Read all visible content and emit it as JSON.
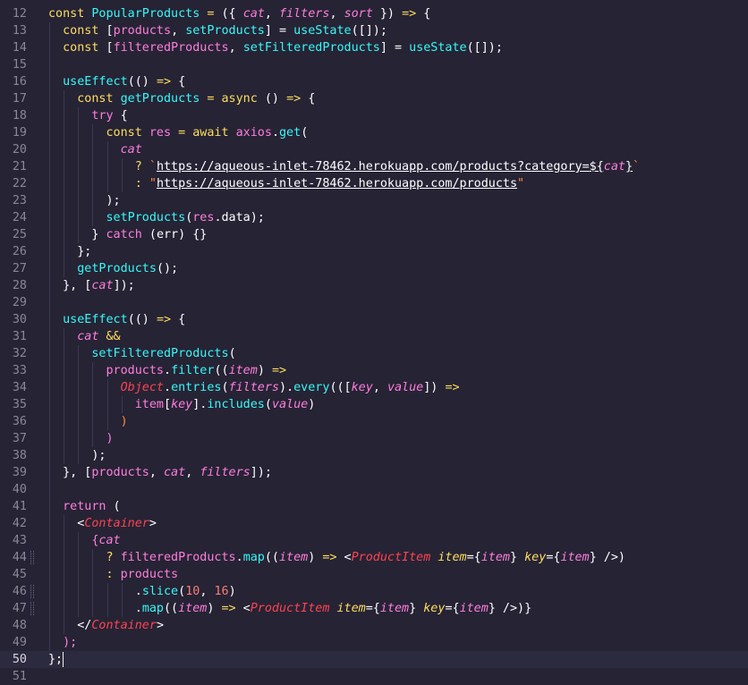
{
  "editor": {
    "active_line": 50,
    "lines": [
      {
        "n": "12",
        "indent": 0,
        "tokens": [
          {
            "t": "const ",
            "c": "kw"
          },
          {
            "t": "PopularProducts",
            "c": "fn"
          },
          {
            "t": " = ",
            "c": "op"
          },
          {
            "t": "({ ",
            "c": "plain"
          },
          {
            "t": "cat",
            "c": "param"
          },
          {
            "t": ", ",
            "c": "plain"
          },
          {
            "t": "filters",
            "c": "param"
          },
          {
            "t": ", ",
            "c": "plain"
          },
          {
            "t": "sort",
            "c": "param"
          },
          {
            "t": " }) ",
            "c": "plain"
          },
          {
            "t": "=>",
            "c": "op"
          },
          {
            "t": " {",
            "c": "plain"
          }
        ]
      },
      {
        "n": "13",
        "indent": 1,
        "tokens": [
          {
            "t": "const ",
            "c": "kw"
          },
          {
            "t": "[",
            "c": "plain"
          },
          {
            "t": "products",
            "c": "var"
          },
          {
            "t": ", ",
            "c": "plain"
          },
          {
            "t": "setProducts",
            "c": "fn"
          },
          {
            "t": "] = ",
            "c": "plain"
          },
          {
            "t": "useState",
            "c": "fn"
          },
          {
            "t": "([]);",
            "c": "plain"
          }
        ]
      },
      {
        "n": "14",
        "indent": 1,
        "tokens": [
          {
            "t": "const ",
            "c": "kw"
          },
          {
            "t": "[",
            "c": "plain"
          },
          {
            "t": "filteredProducts",
            "c": "var"
          },
          {
            "t": ", ",
            "c": "plain"
          },
          {
            "t": "setFilteredProducts",
            "c": "fn"
          },
          {
            "t": "] = ",
            "c": "plain"
          },
          {
            "t": "useState",
            "c": "fn"
          },
          {
            "t": "([]);",
            "c": "plain"
          }
        ]
      },
      {
        "n": "15",
        "indent": 1,
        "tokens": []
      },
      {
        "n": "16",
        "indent": 1,
        "tokens": [
          {
            "t": "useEffect",
            "c": "fn"
          },
          {
            "t": "(() ",
            "c": "plain"
          },
          {
            "t": "=>",
            "c": "op"
          },
          {
            "t": " {",
            "c": "plain"
          }
        ]
      },
      {
        "n": "17",
        "indent": 2,
        "tokens": [
          {
            "t": "const ",
            "c": "kw"
          },
          {
            "t": "getProducts",
            "c": "fn"
          },
          {
            "t": " = ",
            "c": "op"
          },
          {
            "t": "async ",
            "c": "kw"
          },
          {
            "t": "() ",
            "c": "plain"
          },
          {
            "t": "=>",
            "c": "op"
          },
          {
            "t": " {",
            "c": "plain"
          }
        ]
      },
      {
        "n": "18",
        "indent": 3,
        "tokens": [
          {
            "t": "try",
            "c": "var"
          },
          {
            "t": " {",
            "c": "plain"
          }
        ]
      },
      {
        "n": "19",
        "indent": 4,
        "tokens": [
          {
            "t": "const ",
            "c": "kw"
          },
          {
            "t": "res",
            "c": "var"
          },
          {
            "t": " = ",
            "c": "op"
          },
          {
            "t": "await ",
            "c": "kw"
          },
          {
            "t": "axios",
            "c": "var"
          },
          {
            "t": ".",
            "c": "plain"
          },
          {
            "t": "get",
            "c": "fn"
          },
          {
            "t": "(",
            "c": "plain"
          }
        ]
      },
      {
        "n": "20",
        "indent": 5,
        "tokens": [
          {
            "t": "cat",
            "c": "param"
          }
        ]
      },
      {
        "n": "21",
        "indent": 6,
        "tokens": [
          {
            "t": "? ",
            "c": "op"
          },
          {
            "t": "`",
            "c": "str"
          },
          {
            "t": "https://aqueous-inlet-78462.herokuapp.com/products?category=",
            "c": "url"
          },
          {
            "t": "${",
            "c": "url"
          },
          {
            "t": "cat",
            "c": "param"
          },
          {
            "t": "}",
            "c": "url"
          },
          {
            "t": "`",
            "c": "str"
          }
        ]
      },
      {
        "n": "22",
        "indent": 6,
        "tokens": [
          {
            "t": ": ",
            "c": "op"
          },
          {
            "t": "\"",
            "c": "str"
          },
          {
            "t": "https://aqueous-inlet-78462.herokuapp.com/products",
            "c": "url"
          },
          {
            "t": "\"",
            "c": "str"
          }
        ]
      },
      {
        "n": "23",
        "indent": 4,
        "tokens": [
          {
            "t": ");",
            "c": "plain"
          }
        ]
      },
      {
        "n": "24",
        "indent": 4,
        "tokens": [
          {
            "t": "setProducts",
            "c": "fn"
          },
          {
            "t": "(",
            "c": "plain"
          },
          {
            "t": "res",
            "c": "var"
          },
          {
            "t": ".",
            "c": "plain"
          },
          {
            "t": "data",
            "c": "plain"
          },
          {
            "t": ");",
            "c": "plain"
          }
        ]
      },
      {
        "n": "25",
        "indent": 3,
        "tokens": [
          {
            "t": "} ",
            "c": "plain"
          },
          {
            "t": "catch",
            "c": "var"
          },
          {
            "t": " (",
            "c": "plain"
          },
          {
            "t": "err",
            "c": "plain"
          },
          {
            "t": ") {}",
            "c": "plain"
          }
        ]
      },
      {
        "n": "26",
        "indent": 2,
        "tokens": [
          {
            "t": "};",
            "c": "plain"
          }
        ]
      },
      {
        "n": "27",
        "indent": 2,
        "tokens": [
          {
            "t": "getProducts",
            "c": "fn"
          },
          {
            "t": "();",
            "c": "plain"
          }
        ]
      },
      {
        "n": "28",
        "indent": 1,
        "tokens": [
          {
            "t": "}, [",
            "c": "plain"
          },
          {
            "t": "cat",
            "c": "param"
          },
          {
            "t": "]);",
            "c": "plain"
          }
        ]
      },
      {
        "n": "29",
        "indent": 1,
        "tokens": []
      },
      {
        "n": "30",
        "indent": 1,
        "tokens": [
          {
            "t": "useEffect",
            "c": "fn"
          },
          {
            "t": "(() ",
            "c": "plain"
          },
          {
            "t": "=>",
            "c": "op"
          },
          {
            "t": " {",
            "c": "plain"
          }
        ]
      },
      {
        "n": "31",
        "indent": 2,
        "tokens": [
          {
            "t": "cat",
            "c": "param"
          },
          {
            "t": " &&",
            "c": "op"
          }
        ]
      },
      {
        "n": "32",
        "indent": 3,
        "tokens": [
          {
            "t": "setFilteredProducts",
            "c": "fn"
          },
          {
            "t": "(",
            "c": "plain"
          }
        ]
      },
      {
        "n": "33",
        "indent": 4,
        "tokens": [
          {
            "t": "products",
            "c": "var"
          },
          {
            "t": ".",
            "c": "plain"
          },
          {
            "t": "filter",
            "c": "fn"
          },
          {
            "t": "((",
            "c": "plain"
          },
          {
            "t": "item",
            "c": "param"
          },
          {
            "t": ") ",
            "c": "plain"
          },
          {
            "t": "=>",
            "c": "op"
          }
        ]
      },
      {
        "n": "34",
        "indent": 5,
        "tokens": [
          {
            "t": "Object",
            "c": "obj"
          },
          {
            "t": ".",
            "c": "plain"
          },
          {
            "t": "entries",
            "c": "fn"
          },
          {
            "t": "(",
            "c": "plain"
          },
          {
            "t": "filters",
            "c": "param"
          },
          {
            "t": ").",
            "c": "plain"
          },
          {
            "t": "every",
            "c": "fn"
          },
          {
            "t": "(([",
            "c": "plain"
          },
          {
            "t": "key",
            "c": "param"
          },
          {
            "t": ", ",
            "c": "plain"
          },
          {
            "t": "value",
            "c": "param"
          },
          {
            "t": "]) ",
            "c": "plain"
          },
          {
            "t": "=>",
            "c": "op"
          }
        ]
      },
      {
        "n": "35",
        "indent": 6,
        "tokens": [
          {
            "t": "item",
            "c": "var"
          },
          {
            "t": "[",
            "c": "plain"
          },
          {
            "t": "key",
            "c": "param"
          },
          {
            "t": "].",
            "c": "plain"
          },
          {
            "t": "includes",
            "c": "fn"
          },
          {
            "t": "(",
            "c": "plain"
          },
          {
            "t": "value",
            "c": "param"
          },
          {
            "t": ")",
            "c": "plain"
          }
        ]
      },
      {
        "n": "36",
        "indent": 5,
        "tokens": [
          {
            "t": ")",
            "c": "str"
          }
        ]
      },
      {
        "n": "37",
        "indent": 4,
        "tokens": [
          {
            "t": ")",
            "c": "var"
          }
        ]
      },
      {
        "n": "38",
        "indent": 3,
        "tokens": [
          {
            "t": ");",
            "c": "plain"
          }
        ]
      },
      {
        "n": "39",
        "indent": 1,
        "tokens": [
          {
            "t": "}, [",
            "c": "plain"
          },
          {
            "t": "products",
            "c": "var"
          },
          {
            "t": ", ",
            "c": "plain"
          },
          {
            "t": "cat",
            "c": "param"
          },
          {
            "t": ", ",
            "c": "plain"
          },
          {
            "t": "filters",
            "c": "param"
          },
          {
            "t": "]);",
            "c": "plain"
          }
        ]
      },
      {
        "n": "40",
        "indent": 1,
        "tokens": []
      },
      {
        "n": "41",
        "indent": 1,
        "tokens": [
          {
            "t": "return",
            "c": "var"
          },
          {
            "t": " (",
            "c": "plain"
          }
        ]
      },
      {
        "n": "42",
        "indent": 2,
        "tokens": [
          {
            "t": "<",
            "c": "plain"
          },
          {
            "t": "Container",
            "c": "tag"
          },
          {
            "t": ">",
            "c": "plain"
          }
        ]
      },
      {
        "n": "43",
        "indent": 3,
        "tokens": [
          {
            "t": "{",
            "c": "var"
          },
          {
            "t": "cat",
            "c": "param"
          }
        ]
      },
      {
        "n": "44",
        "indent": 4,
        "git": true,
        "tokens": [
          {
            "t": "? ",
            "c": "op"
          },
          {
            "t": "filteredProducts",
            "c": "var"
          },
          {
            "t": ".",
            "c": "plain"
          },
          {
            "t": "map",
            "c": "fn"
          },
          {
            "t": "((",
            "c": "plain"
          },
          {
            "t": "item",
            "c": "param"
          },
          {
            "t": ") ",
            "c": "plain"
          },
          {
            "t": "=>",
            "c": "op"
          },
          {
            "t": " <",
            "c": "plain"
          },
          {
            "t": "ProductItem",
            "c": "tag"
          },
          {
            "t": " ",
            "c": "plain"
          },
          {
            "t": "item",
            "c": "attr"
          },
          {
            "t": "={",
            "c": "plain"
          },
          {
            "t": "item",
            "c": "param"
          },
          {
            "t": "} ",
            "c": "plain"
          },
          {
            "t": "key",
            "c": "attr"
          },
          {
            "t": "={",
            "c": "plain"
          },
          {
            "t": "item",
            "c": "param"
          },
          {
            "t": "} />)",
            "c": "plain"
          }
        ]
      },
      {
        "n": "45",
        "indent": 4,
        "tokens": [
          {
            "t": ": ",
            "c": "op"
          },
          {
            "t": "products",
            "c": "var"
          }
        ]
      },
      {
        "n": "46",
        "indent": 6,
        "git": true,
        "tokens": [
          {
            "t": ".",
            "c": "plain"
          },
          {
            "t": "slice",
            "c": "fn"
          },
          {
            "t": "(",
            "c": "plain"
          },
          {
            "t": "10",
            "c": "num"
          },
          {
            "t": ", ",
            "c": "plain"
          },
          {
            "t": "16",
            "c": "num"
          },
          {
            "t": ")",
            "c": "plain"
          }
        ]
      },
      {
        "n": "47",
        "indent": 6,
        "git": true,
        "tokens": [
          {
            "t": ".",
            "c": "plain"
          },
          {
            "t": "map",
            "c": "fn"
          },
          {
            "t": "((",
            "c": "plain"
          },
          {
            "t": "item",
            "c": "param"
          },
          {
            "t": ") ",
            "c": "plain"
          },
          {
            "t": "=>",
            "c": "op"
          },
          {
            "t": " <",
            "c": "plain"
          },
          {
            "t": "ProductItem",
            "c": "tag"
          },
          {
            "t": " ",
            "c": "plain"
          },
          {
            "t": "item",
            "c": "attr"
          },
          {
            "t": "={",
            "c": "plain"
          },
          {
            "t": "item",
            "c": "param"
          },
          {
            "t": "} ",
            "c": "plain"
          },
          {
            "t": "key",
            "c": "attr"
          },
          {
            "t": "={",
            "c": "plain"
          },
          {
            "t": "item",
            "c": "param"
          },
          {
            "t": "} />)}",
            "c": "plain"
          }
        ]
      },
      {
        "n": "48",
        "indent": 2,
        "tokens": [
          {
            "t": "</",
            "c": "plain"
          },
          {
            "t": "Container",
            "c": "tag"
          },
          {
            "t": ">",
            "c": "plain"
          }
        ]
      },
      {
        "n": "49",
        "indent": 1,
        "tokens": [
          {
            "t": ");",
            "c": "var"
          }
        ]
      },
      {
        "n": "50",
        "indent": 0,
        "cursor": true,
        "tokens": [
          {
            "t": "};",
            "c": "plain"
          }
        ]
      },
      {
        "n": "51",
        "indent": 0,
        "tokens": []
      }
    ]
  }
}
